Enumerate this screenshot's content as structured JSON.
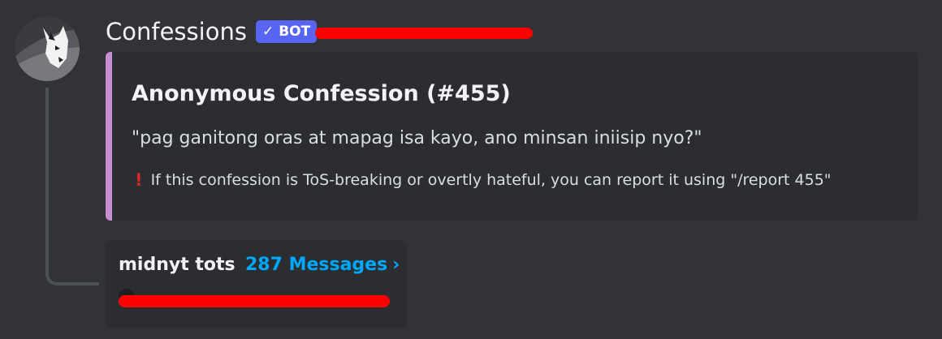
{
  "message": {
    "author": "Confessions",
    "bot_tag": "BOT",
    "timestamp_redacted": true,
    "avatar_icon": "fox-mask-avatar"
  },
  "embed": {
    "accent_color": "#c88fd0",
    "title": "Anonymous Confession (#455)",
    "description": "\"pag ganitong oras at mapag isa kayo, ano minsan iniisip nyo?\"",
    "footer_icon": "!",
    "footer_text": "If this confession is ToS-breaking or overtly hateful, you can report it using \"/report 455\""
  },
  "thread": {
    "name": "midnyt tots",
    "message_count": "287 Messages",
    "chevron": "›",
    "last_message_redacted": true
  },
  "colors": {
    "background": "#313338",
    "embed_background": "#2b2d31",
    "bot_tag": "#5865f2",
    "link": "#00a8fc",
    "redaction": "#ff0000"
  }
}
